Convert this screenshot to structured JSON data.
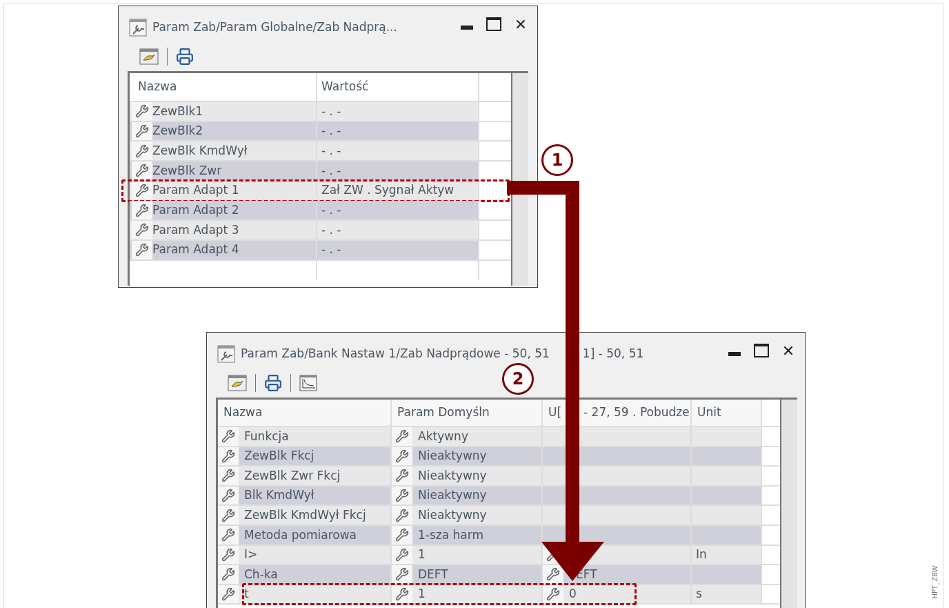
{
  "top_window": {
    "title": "Param Zab/Param Globalne/Zab Nadprą...",
    "columns": [
      "Nazwa",
      "Wartość"
    ],
    "rows": [
      {
        "name": "ZewBlk1",
        "value": "- . -",
        "highlighted": false
      },
      {
        "name": "ZewBlk2",
        "value": "- . -",
        "highlighted": false
      },
      {
        "name": "ZewBlk KmdWył",
        "value": "- . -",
        "highlighted": false
      },
      {
        "name": "ZewBlk Zwr",
        "value": "- . -",
        "highlighted": false
      },
      {
        "name": "Param Adapt 1",
        "value": "Zał ZW . Sygnał Aktyw",
        "highlighted": true
      },
      {
        "name": "Param Adapt 2",
        "value": "- . -",
        "highlighted": false
      },
      {
        "name": "Param Adapt 3",
        "value": "- . -",
        "highlighted": false
      },
      {
        "name": "Param Adapt 4",
        "value": "- . -",
        "highlighted": false
      }
    ]
  },
  "bottom_window": {
    "title": "Param Zab/Bank Nastaw 1/Zab Nadprądowe - 50, 51",
    "title_after_arrow": "1] - 50, 51",
    "columns": [
      {
        "label": "Nazwa"
      },
      {
        "label": "Param Domyśln"
      },
      {
        "label": "U[",
        "label_after_arrow": "- 27, 59 . Pobudze"
      },
      {
        "label": "Unit"
      }
    ],
    "rows": [
      {
        "name": "Funkcja",
        "default": "Aktywny",
        "value_icon": false,
        "highlighted": false
      },
      {
        "name": "ZewBlk Fkcj",
        "default": "Nieaktywny",
        "value_icon": false,
        "highlighted": false
      },
      {
        "name": "ZewBlk Zwr Fkcj",
        "default": "Nieaktywny",
        "value_icon": false,
        "highlighted": false
      },
      {
        "name": "Blk KmdWył",
        "default": "Nieaktywny",
        "value_icon": false,
        "highlighted": false
      },
      {
        "name": "ZewBlk KmdWył Fkcj",
        "default": "Nieaktywny",
        "value_icon": false,
        "highlighted": false
      },
      {
        "name": "Metoda pomiarowa",
        "default": "1-sza harm",
        "value_icon": false,
        "highlighted": false
      },
      {
        "name": "I>",
        "default": "1",
        "value_icon": true,
        "unit": "In",
        "highlighted": false
      },
      {
        "name": "Ch-ka",
        "default": "DEFT",
        "value_icon": true,
        "value": "EFT",
        "highlighted": false
      },
      {
        "name": "t",
        "default": "1",
        "value_icon": true,
        "value": "0",
        "unit": "s",
        "highlighted": true
      }
    ]
  },
  "callouts": [
    {
      "number": "1"
    },
    {
      "number": "2"
    }
  ],
  "document_code": "HPT_ZBW"
}
